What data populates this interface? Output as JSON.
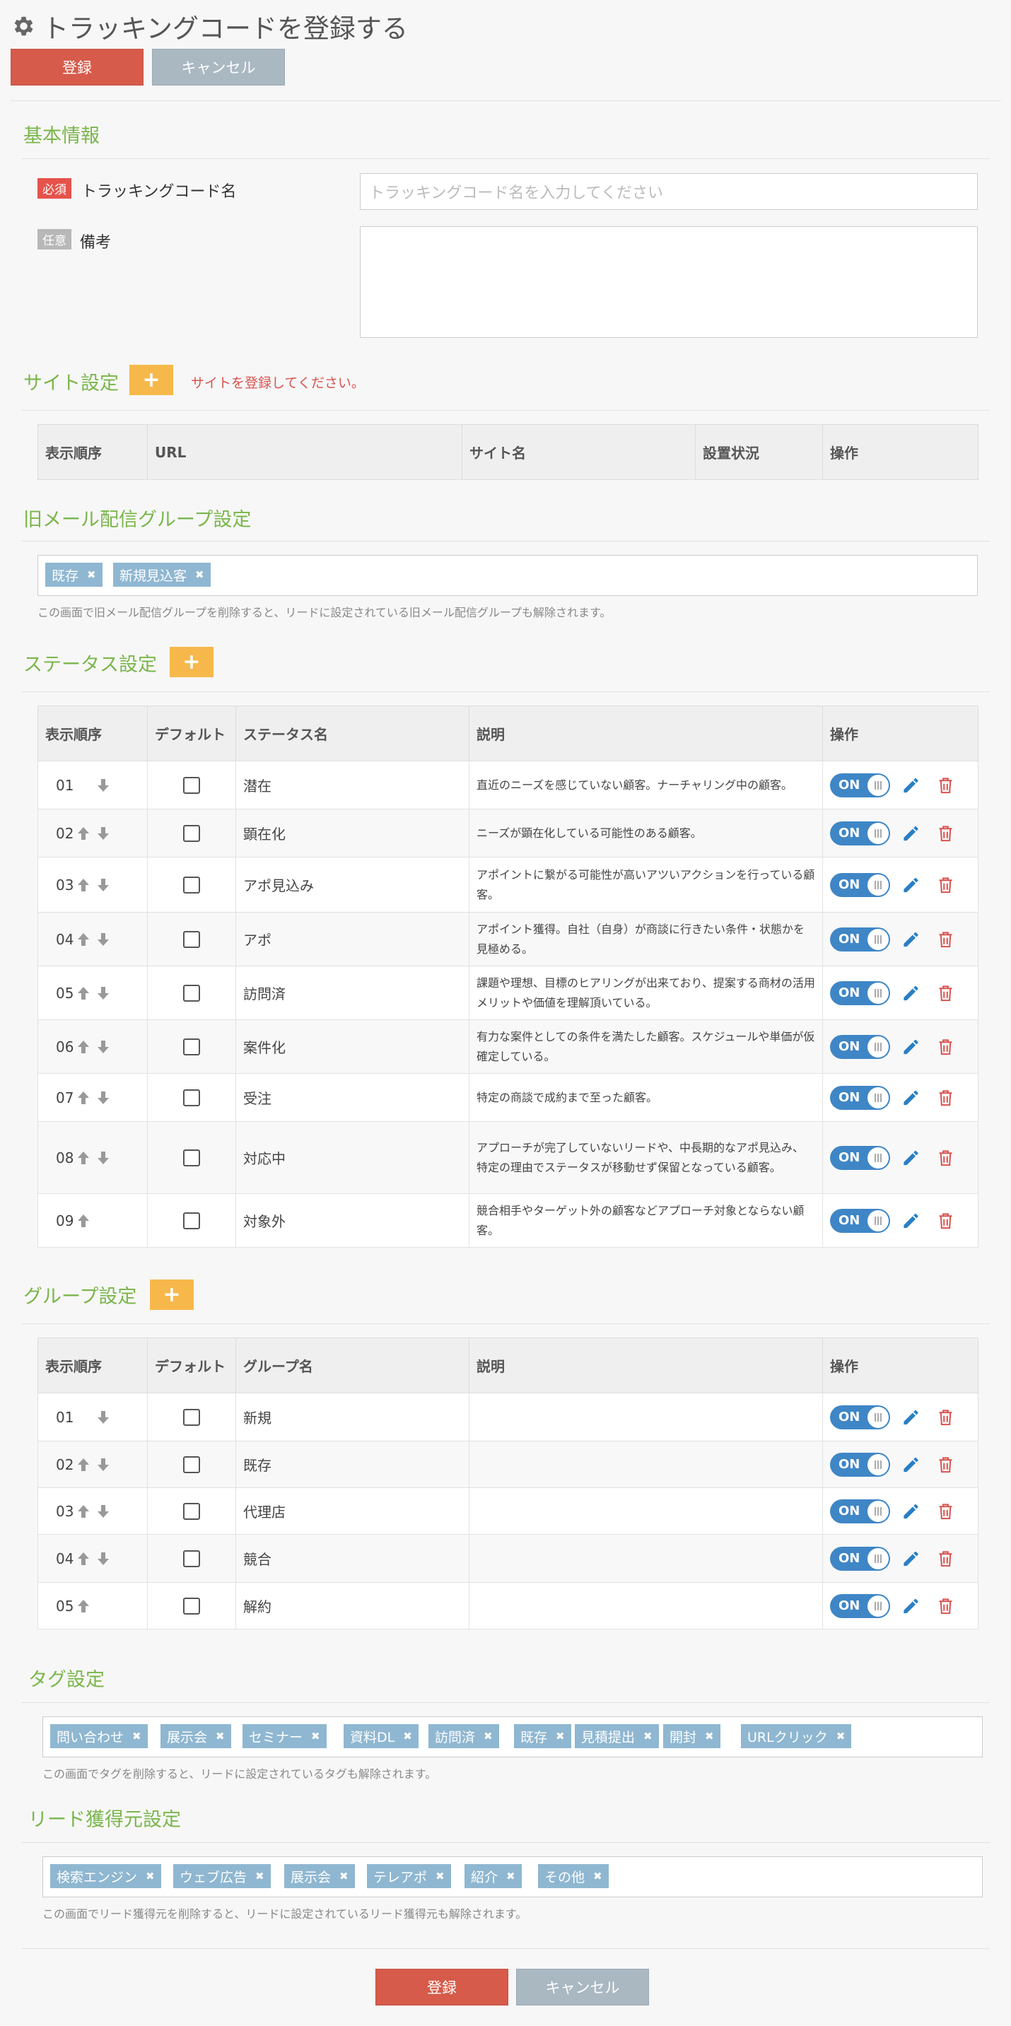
{
  "header": {
    "title": "トラッキングコードを登録する",
    "save_label": "登録",
    "cancel_label": "キャンセル"
  },
  "basic": {
    "heading": "基本情報",
    "required_badge": "必須",
    "optional_badge": "任意",
    "name_label": "トラッキングコード名",
    "name_placeholder": "トラッキングコード名を入力してください",
    "memo_label": "備考",
    "memo_value": ""
  },
  "site": {
    "heading": "サイト設定",
    "warning": "サイトを登録してください。",
    "columns": [
      "表示順序",
      "URL",
      "サイト名",
      "設置状況",
      "操作"
    ]
  },
  "mail_groups": {
    "heading": "旧メール配信グループ設定",
    "tags": [
      "既存",
      "新規見込客"
    ],
    "note": "この画面で旧メール配信グループを削除すると、リードに設定されている旧メール配信グループも解除されます。"
  },
  "status": {
    "heading": "ステータス設定",
    "columns": [
      "表示順序",
      "デフォルト",
      "ステータス名",
      "説明",
      "操作"
    ],
    "toggle_label": "ON",
    "rows": [
      {
        "order": "01",
        "name": "潜在",
        "desc": "直近のニーズを感じていない顧客。ナーチャリング中の顧客。"
      },
      {
        "order": "02",
        "name": "顕在化",
        "desc": "ニーズが顕在化している可能性のある顧客。"
      },
      {
        "order": "03",
        "name": "アポ見込み",
        "desc": "アポイントに繋がる可能性が高いアツいアクションを行っている顧客。"
      },
      {
        "order": "04",
        "name": "アポ",
        "desc": "アポイント獲得。自社（自身）が商談に行きたい条件・状態かを見極める。"
      },
      {
        "order": "05",
        "name": "訪問済",
        "desc": "課題や理想、目標のヒアリングが出来ており、提案する商材の活用メリットや価値を理解頂いている。"
      },
      {
        "order": "06",
        "name": "案件化",
        "desc": "有力な案件としての条件を満たした顧客。スケジュールや単価が仮確定している。"
      },
      {
        "order": "07",
        "name": "受注",
        "desc": "特定の商談で成約まで至った顧客。"
      },
      {
        "order": "08",
        "name": "対応中",
        "desc": "アプローチが完了していないリードや、中長期的なアポ見込み、特定の理由でステータスが移動せず保留となっている顧客。"
      },
      {
        "order": "09",
        "name": "対象外",
        "desc": "競合相手やターゲット外の顧客などアプローチ対象とならない顧客。"
      }
    ]
  },
  "groups": {
    "heading": "グループ設定",
    "columns": [
      "表示順序",
      "デフォルト",
      "グループ名",
      "説明",
      "操作"
    ],
    "rows": [
      {
        "order": "01",
        "name": "新規",
        "desc": ""
      },
      {
        "order": "02",
        "name": "既存",
        "desc": ""
      },
      {
        "order": "03",
        "name": "代理店",
        "desc": ""
      },
      {
        "order": "04",
        "name": "競合",
        "desc": ""
      },
      {
        "order": "05",
        "name": "解約",
        "desc": ""
      }
    ]
  },
  "tags": {
    "heading": "タグ設定",
    "items": [
      "問い合わせ",
      "展示会",
      "セミナー",
      "資料DL",
      "訪問済",
      "既存",
      "見積提出",
      "開封",
      "URLクリック"
    ],
    "note": "この画面でタグを削除すると、リードに設定されているタグも解除されます。"
  },
  "lead_sources": {
    "heading": "リード獲得元設定",
    "items": [
      "検索エンジン",
      "ウェブ広告",
      "展示会",
      "テレアポ",
      "紹介",
      "その他"
    ],
    "note": "この画面でリード獲得元を削除すると、リードに設定されているリード獲得元も解除されます。"
  },
  "footer": {
    "save_label": "登録",
    "cancel_label": "キャンセル"
  },
  "colors": {
    "accent_green": "#7ab64b",
    "save_red": "#d65b4a",
    "cancel_gray": "#aab8c2",
    "add_orange": "#f7b84b",
    "toggle_blue": "#3f86c6",
    "tag_blue": "#8fb7d1"
  }
}
